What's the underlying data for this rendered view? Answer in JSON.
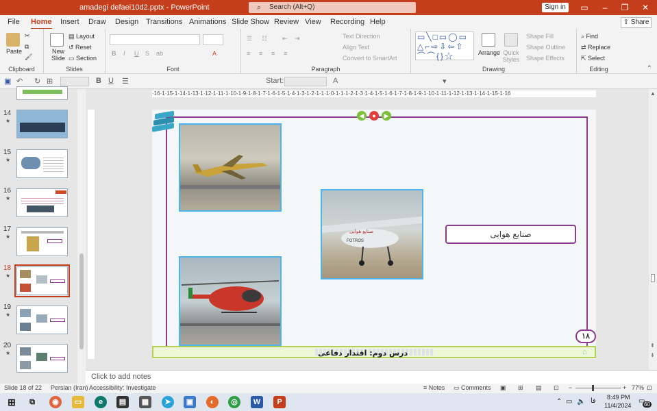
{
  "titlebar": {
    "doc_title": "amadegi defaei10d2.pptx  -  PowerPoint",
    "search_placeholder": "Search (Alt+Q)",
    "sign_in": "Sign in",
    "minimize": "–",
    "restore": "❐",
    "close": "✕"
  },
  "menu": {
    "tabs": [
      "File",
      "Home",
      "Insert",
      "Draw",
      "Design",
      "Transitions",
      "Animations",
      "Slide Show",
      "Review",
      "View",
      "Recording",
      "Help"
    ],
    "share": "Share"
  },
  "ribbon": {
    "clipboard": {
      "label": "Clipboard",
      "paste": "Paste"
    },
    "slides": {
      "label": "Slides",
      "new_slide": "New Slide",
      "layout": "Layout",
      "reset": "Reset",
      "section": "Section"
    },
    "font": {
      "label": "Font"
    },
    "paragraph": {
      "label": "Paragraph",
      "text_direction": "Text Direction",
      "align_text": "Align Text",
      "convert_smartart": "Convert to SmartArt"
    },
    "drawing": {
      "label": "Drawing",
      "arrange": "Arrange",
      "quick_styles": "Quick Styles",
      "shape_fill": "Shape Fill",
      "shape_outline": "Shape Outline",
      "shape_effects": "Shape Effects"
    },
    "editing": {
      "label": "Editing",
      "find": "Find",
      "replace": "Replace",
      "select": "Select"
    }
  },
  "qat": {
    "start_label": "Start:"
  },
  "thumbnails": [
    {
      "num": "14",
      "star": "★"
    },
    {
      "num": "15",
      "star": "★"
    },
    {
      "num": "16",
      "star": "★"
    },
    {
      "num": "17",
      "star": "★"
    },
    {
      "num": "18",
      "star": "★",
      "selected": true
    },
    {
      "num": "19",
      "star": "★"
    },
    {
      "num": "20",
      "star": "★"
    }
  ],
  "ruler": {
    "marks": "·16·1·15·1·14·1·13·1·12·1·11·1·10·1·9·1·8·1·7·1·6·1·5·1·4·1·3·1·2·1·1·1·0·1·1·1·2·1·3·1·4·1·5·1·6·1·7·1·8·1·9·1·10·1·11·1·12·1·13·1·14·1·15·1·16"
  },
  "slide": {
    "label_text": "صنایع هوایی",
    "footer_text": "درس دوم: اقتدار دفاعی",
    "page_number": "۱۸",
    "drone_marking": "FOTROS"
  },
  "notes": {
    "placeholder": "Click to add notes"
  },
  "status": {
    "slide_of": "Slide 18 of 22",
    "language": "Persian (Iran)",
    "accessibility": "Accessibility: Investigate",
    "notes": "Notes",
    "comments": "Comments",
    "zoom": "77%"
  },
  "taskbar": {
    "time": "8:49 PM",
    "date": "11/4/2024",
    "lang": "فا",
    "notif": "60"
  },
  "colors": {
    "accent": "#c43e1c",
    "frame": "#8e3a8c",
    "photo_border": "#4db4ef",
    "footer_border": "#b4cf54"
  }
}
